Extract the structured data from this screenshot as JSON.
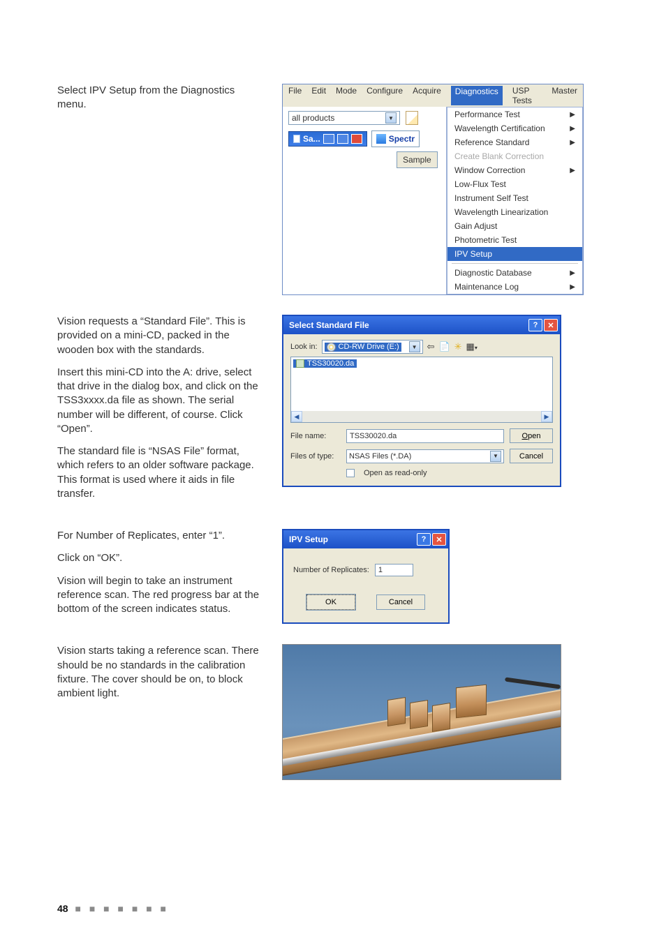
{
  "para": {
    "p1": "Select IPV Setup from the Diagnostics menu.",
    "p2": "Vision requests a “Standard File”. This is provided on a mini-CD, packed in the wooden box with the standards.",
    "p3": "Insert this mini-CD into the A: drive, select that drive in the dialog box, and click on the TSS3xxxx.da file as shown. The serial number will be different, of course. Click “Open”.",
    "p4": "The standard file is “NSAS File” format, which refers to an older software package. This format is used where it aids in file transfer.",
    "p5": "For Number of Replicates, enter “1”.",
    "p6": "Click on “OK”.",
    "p7": "Vision will begin to take an instrument reference scan. The red progress bar at the bottom of the screen indicates status.",
    "p8": "Vision starts taking a reference scan. There should be no standards in the calibration fixture. The cover should be on, to block ambient light."
  },
  "menubar": [
    "File",
    "Edit",
    "Mode",
    "Configure",
    "Acquire",
    "Diagnostics",
    "USP Tests",
    "Master"
  ],
  "toolbar": {
    "combo_value": "all products",
    "sa_label": "Sa...",
    "spectr_label": "Spectr",
    "sample_label": "Sample"
  },
  "dropdown_items": [
    {
      "label": "Performance Test",
      "sub": true
    },
    {
      "label": "Wavelength Certification",
      "sub": true
    },
    {
      "label": "Reference Standard",
      "sub": true
    },
    {
      "label": "Create Blank Correction",
      "disabled": true
    },
    {
      "label": "Window Correction",
      "sub": true
    },
    {
      "label": "Low-Flux Test"
    },
    {
      "label": "Instrument Self Test"
    },
    {
      "label": "Wavelength Linearization"
    },
    {
      "label": "Gain Adjust"
    },
    {
      "label": "Photometric Test"
    },
    {
      "label": "IPV Setup",
      "selected": true
    },
    {
      "sep": true
    },
    {
      "label": "Diagnostic Database",
      "sub": true
    },
    {
      "label": "Maintenance Log",
      "sub": true
    }
  ],
  "filedlg": {
    "title": "Select Standard File",
    "lookin_label": "Look in:",
    "lookin_value": "CD-RW Drive (E:)",
    "file_item": "TSS30020.da",
    "filename_label": "File name:",
    "filename_value": "TSS30020.da",
    "filetype_label": "Files of type:",
    "filetype_value": "NSAS Files (*.DA)",
    "open_btn": "Open",
    "cancel_btn": "Cancel",
    "readonly_label": "Open as read-only"
  },
  "ipvdlg": {
    "title": "IPV Setup",
    "replicates_label": "Number of Replicates:",
    "replicates_value": "1",
    "ok_btn": "OK",
    "cancel_btn": "Cancel"
  },
  "page_number": "48"
}
